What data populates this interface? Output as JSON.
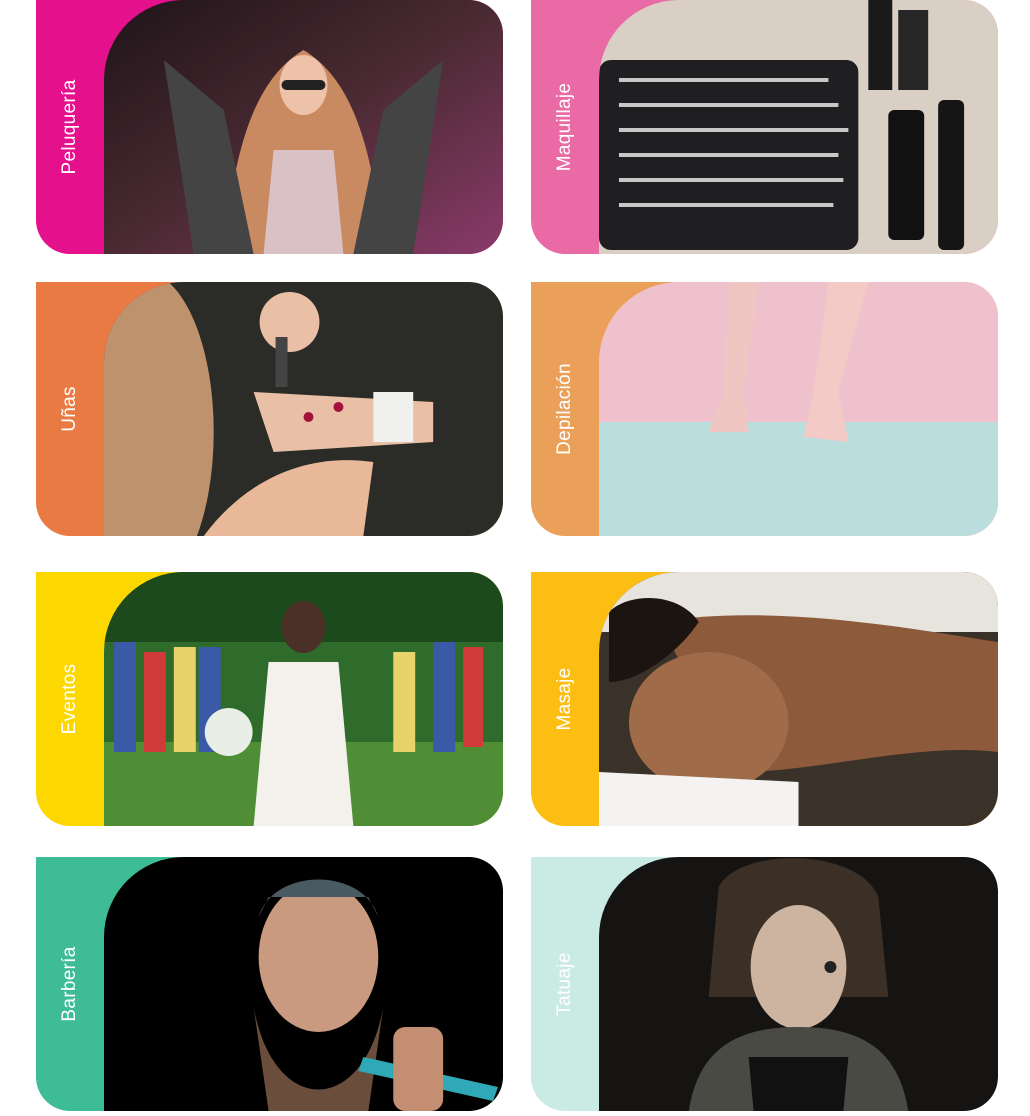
{
  "categories": [
    {
      "id": "peluqueria",
      "label": "Peluquería",
      "accent": "#e5118c",
      "icon": "hair-photo"
    },
    {
      "id": "maquillaje",
      "label": "Maquillaje",
      "accent": "#e96aa4",
      "icon": "makeup-photo"
    },
    {
      "id": "unas",
      "label": "Uñas",
      "accent": "#ea7a43",
      "icon": "nails-photo"
    },
    {
      "id": "depilacion",
      "label": "Depilación",
      "accent": "#eba059",
      "icon": "waxing-photo"
    },
    {
      "id": "eventos",
      "label": "Eventos",
      "accent": "#fdd800",
      "icon": "event-photo"
    },
    {
      "id": "masaje",
      "label": "Masaje",
      "accent": "#fdbe14",
      "icon": "massage-photo"
    },
    {
      "id": "barberia",
      "label": "Barbería",
      "accent": "#3dbc96",
      "icon": "barber-photo"
    },
    {
      "id": "tatuaje",
      "label": "Tatuaje",
      "accent": "#c9ebe3",
      "icon": "tattoo-photo"
    }
  ]
}
